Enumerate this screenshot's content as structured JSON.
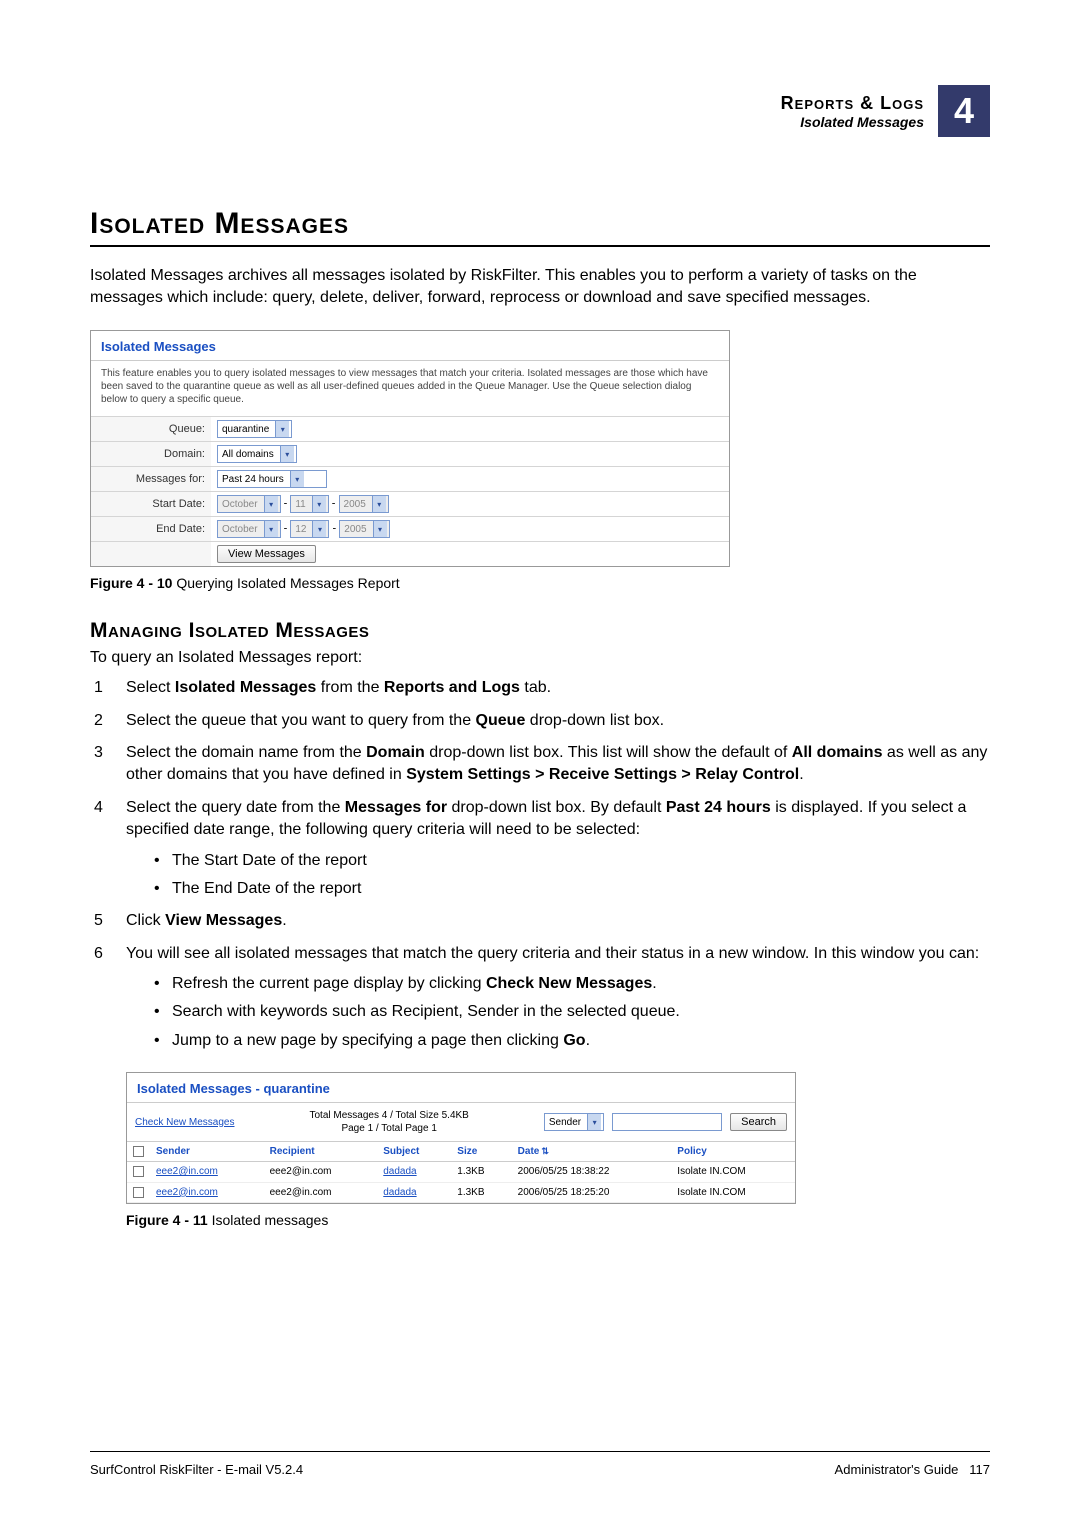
{
  "header": {
    "section_title": "Reports & Logs",
    "subtitle": "Isolated Messages",
    "chapter": "4"
  },
  "h1": "Isolated Messages",
  "intro": "Isolated Messages archives all messages isolated by RiskFilter. This enables you to perform a variety of tasks on the messages which include: query, delete, deliver, forward, reprocess or download and save specified messages.",
  "panel1": {
    "title": "Isolated Messages",
    "desc": "This feature enables you to query isolated messages to view messages that match your criteria. Isolated messages are those which have been saved to the quarantine queue as well as all user-defined queues added in the Queue Manager. Use the Queue selection dialog below to query a specific queue.",
    "labels": {
      "queue": "Queue:",
      "domain": "Domain:",
      "messages_for": "Messages for:",
      "start_date": "Start Date:",
      "end_date": "End Date:"
    },
    "values": {
      "queue": "quarantine",
      "domain": "All domains",
      "messages_for": "Past 24 hours",
      "start_month": "October",
      "start_day": "11",
      "start_year": "2005",
      "end_month": "October",
      "end_day": "12",
      "end_year": "2005"
    },
    "button": "View Messages"
  },
  "fig1_caption_bold": "Figure 4 - 10",
  "fig1_caption": " Querying Isolated Messages Report",
  "h2": "Managing Isolated Messages",
  "lead": "To query an Isolated Messages report:",
  "steps": {
    "s1a": "Select ",
    "s1b": "Isolated Messages",
    "s1c": " from the ",
    "s1d": "Reports and Logs",
    "s1e": " tab.",
    "s2a": "Select the queue that you want to query from the ",
    "s2b": "Queue",
    "s2c": " drop-down list box.",
    "s3a": "Select the domain name from the ",
    "s3b": "Domain",
    "s3c": " drop-down list box. This list will show the default of ",
    "s3d": "All domains",
    "s3e": " as well as any other domains that you have defined in ",
    "s3f": "System Settings > Receive Settings > Relay Control",
    "s3g": ".",
    "s4a": "Select the query date from the ",
    "s4b": "Messages for",
    "s4c": "  drop-down list box. By default ",
    "s4d": "Past 24 hours",
    "s4e": " is displayed. If you select a specified date range, the following query criteria will need to be selected:",
    "s4_b1": "The Start Date of the report",
    "s4_b2": "The End Date of the report",
    "s5a": "Click ",
    "s5b": "View Messages",
    "s5c": ".",
    "s6a": "You will see all isolated messages that match the query criteria and their status in a new window. In this window you can:",
    "s6_b1a": "Refresh the current page display by clicking ",
    "s6_b1b": "Check New Messages",
    "s6_b1c": ".",
    "s6_b2": "Search with keywords such as Recipient, Sender in the selected queue.",
    "s6_b3a": "Jump to a new page by specifying a page then clicking ",
    "s6_b3b": "Go",
    "s6_b3c": "."
  },
  "panel2": {
    "title": "Isolated Messages - quarantine",
    "link": "Check New Messages",
    "mid1": "Total Messages 4 / Total Size 5.4KB",
    "mid2": "Page 1 / Total Page 1",
    "search_field": "Sender",
    "search_btn": "Search",
    "headers": {
      "sender": "Sender",
      "recipient": "Recipient",
      "subject": "Subject",
      "size": "Size",
      "date": "Date",
      "policy": "Policy"
    },
    "rows": [
      {
        "sender": "eee2@in.com",
        "recipient": "eee2@in.com",
        "subject": "dadada",
        "size": "1.3KB",
        "date": "2006/05/25 18:38:22",
        "policy": "Isolate IN.COM"
      },
      {
        "sender": "eee2@in.com",
        "recipient": "eee2@in.com",
        "subject": "dadada",
        "size": "1.3KB",
        "date": "2006/05/25 18:25:20",
        "policy": "Isolate IN.COM"
      }
    ]
  },
  "fig2_caption_bold": "Figure 4 - 11",
  "fig2_caption": " Isolated messages",
  "footer": {
    "left": "SurfControl RiskFilter - E-mail V5.2.4",
    "right_a": "Administrator's Guide",
    "right_b": "117"
  }
}
